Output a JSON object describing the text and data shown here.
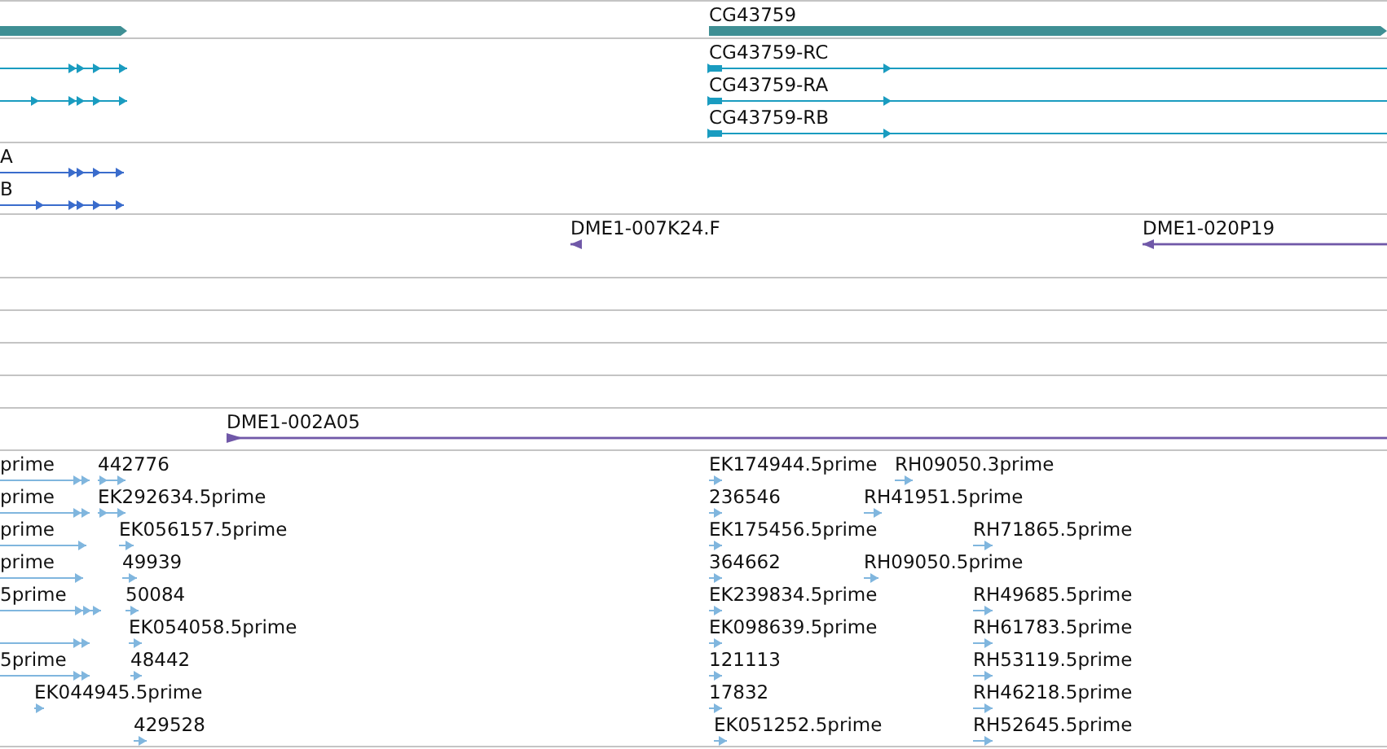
{
  "tracks": [
    {
      "kind": "gene",
      "rows": [
        [
          {
            "reverse": false
          },
          {
            "label": "CG43759",
            "reverse": false
          }
        ]
      ]
    },
    {
      "kind": "transcript",
      "rows": [
        [
          {
            "reverse": false
          },
          {
            "label": "CG43759-RC",
            "reverse": false
          }
        ],
        [
          {
            "reverse": false
          },
          {
            "label": "CG43759-RA",
            "reverse": false
          }
        ],
        [
          {
            "label": "CG43759-RB",
            "reverse": false
          }
        ]
      ]
    },
    {
      "kind": "mrna",
      "rows": [
        [
          {
            "label": "A",
            "reverse": false
          }
        ],
        [
          {
            "label": "B",
            "reverse": false
          }
        ]
      ]
    },
    {
      "kind": "clone",
      "rows": [
        [
          {
            "label": "DME1-007K24.F",
            "reverse": true
          },
          {
            "label": "DME1-020P19",
            "reverse": true
          }
        ]
      ]
    },
    {
      "kind": "empty"
    },
    {
      "kind": "empty"
    },
    {
      "kind": "empty"
    },
    {
      "kind": "empty"
    },
    {
      "kind": "clone",
      "rows": [
        [
          {
            "label": "DME1-002A05",
            "reverse": false
          }
        ]
      ]
    },
    {
      "kind": "est",
      "rows": [
        [
          {
            "label": "prime",
            "reverse": false
          },
          {
            "label": "442776",
            "reverse": false
          },
          {
            "label": "EK174944.5prime",
            "reverse": false
          },
          {
            "label": "RH09050.3prime",
            "reverse": false
          }
        ],
        [
          {
            "label": "prime",
            "reverse": false
          },
          {
            "label": "EK292634.5prime",
            "reverse": false
          },
          {
            "label": "236546",
            "reverse": false
          },
          {
            "label": "RH41951.5prime",
            "reverse": false
          }
        ],
        [
          {
            "label": "prime",
            "reverse": false
          },
          {
            "label": "EK056157.5prime",
            "reverse": false
          },
          {
            "label": "EK175456.5prime",
            "reverse": false
          },
          {
            "label": "RH71865.5prime",
            "reverse": false
          }
        ],
        [
          {
            "label": "prime",
            "reverse": false
          },
          {
            "label": "49939",
            "reverse": false
          },
          {
            "label": "364662",
            "reverse": false
          },
          {
            "label": "RH09050.5prime",
            "reverse": false
          }
        ],
        [
          {
            "label": "5prime",
            "reverse": false
          },
          {
            "label": "50084",
            "reverse": false
          },
          {
            "label": "EK239834.5prime",
            "reverse": false
          },
          {
            "label": "RH49685.5prime",
            "reverse": false
          }
        ],
        [
          {
            "reverse": false
          },
          {
            "label": "EK054058.5prime",
            "reverse": false
          },
          {
            "label": "EK098639.5prime",
            "reverse": false
          },
          {
            "label": "RH61783.5prime",
            "reverse": false
          }
        ],
        [
          {
            "label": "5prime",
            "reverse": false
          },
          {
            "label": "48442",
            "reverse": false
          },
          {
            "label": "121113",
            "reverse": false
          },
          {
            "label": "RH53119.5prime",
            "reverse": false
          }
        ],
        [
          {
            "label": "EK044945.5prime",
            "reverse": false
          },
          {
            "label": "17832",
            "reverse": false
          },
          {
            "label": "RH46218.5prime",
            "reverse": false
          }
        ],
        [
          {
            "label": "429528",
            "reverse": false
          },
          {
            "label": "EK051252.5prime",
            "reverse": false
          },
          {
            "label": "RH52645.5prime",
            "reverse": false
          }
        ]
      ]
    }
  ]
}
